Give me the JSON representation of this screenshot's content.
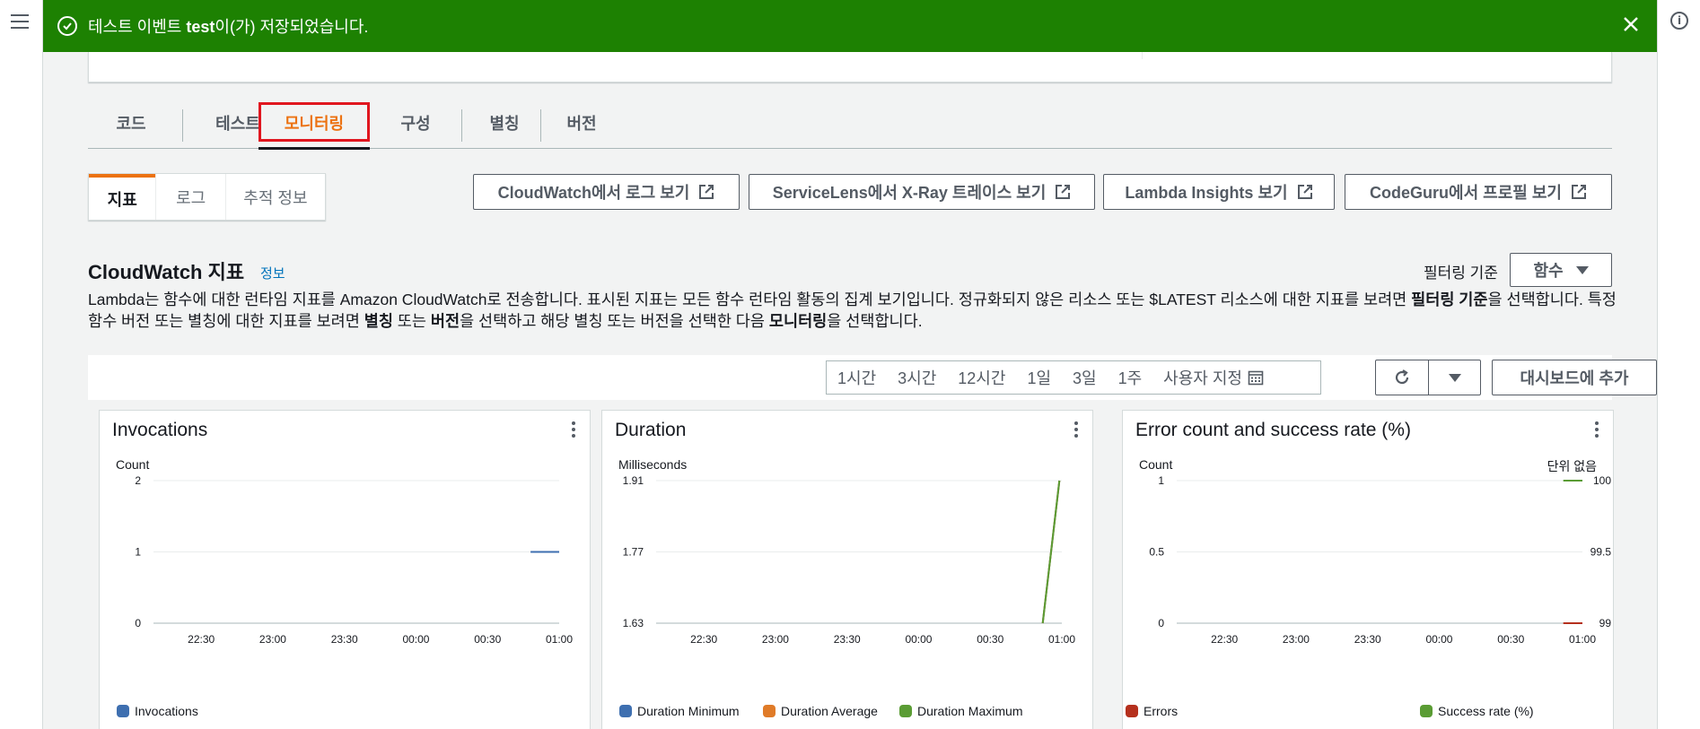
{
  "flash": {
    "message_prefix": "테스트 이벤트 ",
    "message_bold": "test",
    "message_suffix": "이(가) 저장되었습니다."
  },
  "tabs": [
    "코드",
    "테스트",
    "모니터링",
    "구성",
    "별칭",
    "버전"
  ],
  "active_tab": "모니터링",
  "subtabs": [
    "지표",
    "로그",
    "추적 정보"
  ],
  "buttons": {
    "cloudwatch_logs": "CloudWatch에서 로그 보기",
    "xray": "ServiceLens에서 X-Ray 트레이스 보기",
    "insights": "Lambda Insights 보기",
    "codeguru": "CodeGuru에서 프로필 보기",
    "add_dashboard": "대시보드에 추가"
  },
  "section": {
    "title": "CloudWatch 지표",
    "info": "정보",
    "filter_label": "필터링 기준",
    "filter_value": "함수",
    "desc_1": "Lambda는 함수에 대한 런타임 지표를 Amazon CloudWatch로 전송합니다. 표시된 지표는 모든 함수 런타임 활동의 집계 보기입니다. 정규화되지 않은 리소스 또는 $LATEST 리소스에 대한 지표를 보려면 ",
    "desc_b1": "필터링 기준",
    "desc_2": "을 선택합니다. 특정 함수 버전 또는 별칭에 대한 지표를 보려면 ",
    "desc_b2": "별칭",
    "desc_3": " 또는 ",
    "desc_b3": "버전",
    "desc_4": "을 선택하고 해당 별칭 또는 버전을 선택한 다음 ",
    "desc_b4": "모니터링",
    "desc_5": "을 선택합니다."
  },
  "time_ranges": [
    "1시간",
    "3시간",
    "12시간",
    "1일",
    "3일",
    "1주"
  ],
  "custom_range": "사용자 지정",
  "colors": {
    "blue": "#3e6fb0",
    "orange": "#e07b28",
    "green": "#5a9c34",
    "red": "#b5301d",
    "flash_green": "#1d8102"
  },
  "chart_data": [
    {
      "type": "line",
      "title": "Invocations",
      "ylabel": "Count",
      "ylim": [
        0,
        2
      ],
      "yticks": [
        "2",
        "1",
        "0"
      ],
      "x": [
        "22:30",
        "23:00",
        "23:30",
        "00:00",
        "00:30",
        "01:00"
      ],
      "series": [
        {
          "name": "Invocations",
          "color": "#3e6fb0",
          "points": [
            [
              "00:48",
              1
            ],
            [
              "01:00",
              1
            ]
          ]
        }
      ]
    },
    {
      "type": "line",
      "title": "Duration",
      "ylabel": "Milliseconds",
      "ylim": [
        1.63,
        1.91
      ],
      "yticks": [
        "1.91",
        "1.77",
        "1.63"
      ],
      "x": [
        "22:30",
        "23:00",
        "23:30",
        "00:00",
        "00:30",
        "01:00"
      ],
      "series": [
        {
          "name": "Duration Minimum",
          "color": "#3e6fb0",
          "points": [
            [
              "00:52",
              1.63
            ],
            [
              "00:59",
              1.91
            ]
          ]
        },
        {
          "name": "Duration Average",
          "color": "#e07b28",
          "points": [
            [
              "00:52",
              1.63
            ],
            [
              "00:59",
              1.91
            ]
          ]
        },
        {
          "name": "Duration Maximum",
          "color": "#5a9c34",
          "points": [
            [
              "00:52",
              1.63
            ],
            [
              "00:59",
              1.91
            ]
          ]
        }
      ]
    },
    {
      "type": "line",
      "title": "Error count and success rate (%)",
      "ylabel": "Count",
      "y2label": "단위 없음",
      "ylim": [
        0,
        1
      ],
      "y2lim": [
        99,
        100
      ],
      "yticks": [
        "1",
        "0.5",
        "0"
      ],
      "y2ticks": [
        "100",
        "99.5",
        "99"
      ],
      "x": [
        "22:30",
        "23:00",
        "23:30",
        "00:00",
        "00:30",
        "01:00"
      ],
      "series": [
        {
          "name": "Errors",
          "color": "#b5301d",
          "axis": "left",
          "points": [
            [
              "00:52",
              0
            ],
            [
              "01:00",
              0
            ]
          ]
        },
        {
          "name": "Success rate (%)",
          "color": "#5a9c34",
          "axis": "right",
          "points": [
            [
              "00:52",
              100
            ],
            [
              "01:00",
              100
            ]
          ]
        }
      ]
    }
  ]
}
